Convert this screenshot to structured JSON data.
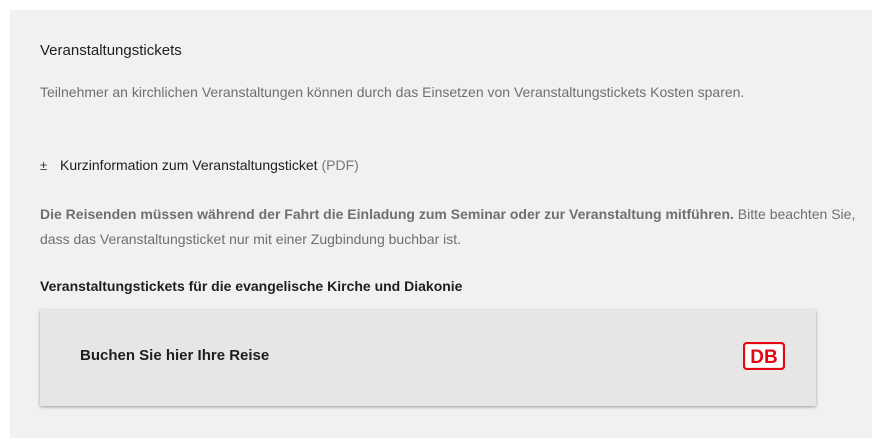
{
  "section": {
    "title": "Veranstaltungstickets",
    "intro": "Teilnehmer an kirchlichen Veranstaltungen können durch das Einsetzen von Veranstaltungstickets Kosten sparen.",
    "download": {
      "icon": "download-icon",
      "label": "Kurzinformation zum Veranstaltungsticket",
      "format": "(PDF)"
    },
    "note_bold": "Die Reisenden müssen während der Fahrt die Einladung zum Seminar oder zur Veranstaltung mitführen.",
    "note_rest": " Bitte beachten Sie, dass das Veranstaltungsticket nur mit einer Zugbindung buchbar ist.",
    "subheading": "Veranstaltungstickets für die evangelische Kirche und Diakonie"
  },
  "booking": {
    "label": "Buchen Sie hier Ihre Reise",
    "logo_text": "DB",
    "logo_color": "#e30613"
  },
  "colors": {
    "panel_bg": "#f1f1f1",
    "button_bg": "#e6e6e6",
    "muted_text": "#6f6f6f",
    "dark_text": "#1e1e1e"
  }
}
